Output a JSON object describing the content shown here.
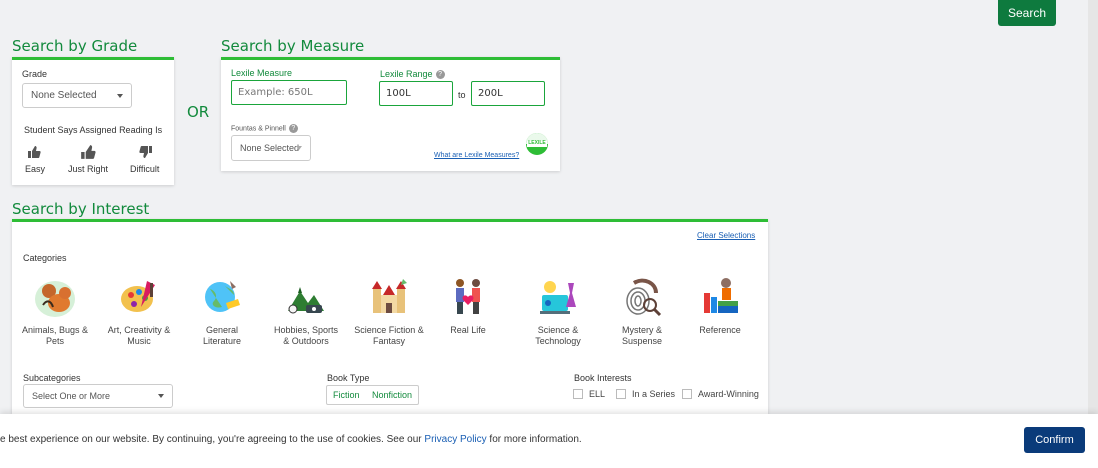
{
  "top_search_label": "Search",
  "grade_section": {
    "title": "Search by Grade",
    "grade_label": "Grade",
    "grade_value": "None Selected",
    "reading_label": "Student Says Assigned Reading Is",
    "options": [
      "Easy",
      "Just Right",
      "Difficult"
    ]
  },
  "or_text": "OR",
  "measure_section": {
    "title": "Search by Measure",
    "lexile_measure_label": "Lexile Measure",
    "lexile_measure_placeholder": "Example: 650L",
    "lexile_range_label": "Lexile Range",
    "range_from": "100L",
    "range_to_label": "to",
    "range_to": "200L",
    "fp_label": "Fountas & Pinnell",
    "fp_value": "None Selected",
    "what_are_link": "What are Lexile Measures?",
    "logo_text": "LEXILE"
  },
  "interest_section": {
    "title": "Search by Interest",
    "clear_link": "Clear Selections",
    "categories_label": "Categories",
    "categories": [
      {
        "label": "Animals, Bugs & Pets",
        "icon": "animals-icon"
      },
      {
        "label": "Art, Creativity & Music",
        "icon": "art-icon"
      },
      {
        "label": "General Literature",
        "icon": "globe-icon"
      },
      {
        "label": "Hobbies, Sports & Outdoors",
        "icon": "hobbies-icon"
      },
      {
        "label": "Science Fiction & Fantasy",
        "icon": "castle-icon"
      },
      {
        "label": "Real Life",
        "icon": "family-icon"
      },
      {
        "label": "Science & Technology",
        "icon": "science-icon"
      },
      {
        "label": "Mystery & Suspense",
        "icon": "fingerprint-icon"
      },
      {
        "label": "Reference",
        "icon": "books-icon"
      }
    ],
    "subcategories_label": "Subcategories",
    "subcategories_value": "Select One or More",
    "book_type_label": "Book Type",
    "book_types": [
      "Fiction",
      "Nonfiction"
    ],
    "book_interests_label": "Book Interests",
    "book_interests": [
      "ELL",
      "In a Series",
      "Award-Winning"
    ]
  },
  "cookie": {
    "text_before": "e best experience on our website. By continuing, you're agreeing to the use of cookies. See our ",
    "link": "Privacy Policy",
    "text_after": " for more information.",
    "confirm_label": "Confirm"
  },
  "colors": {
    "accent_green": "#128a3c",
    "bar_green": "#2ebd36",
    "button_green": "#0e7a3e",
    "confirm_blue": "#0a3b7a"
  }
}
